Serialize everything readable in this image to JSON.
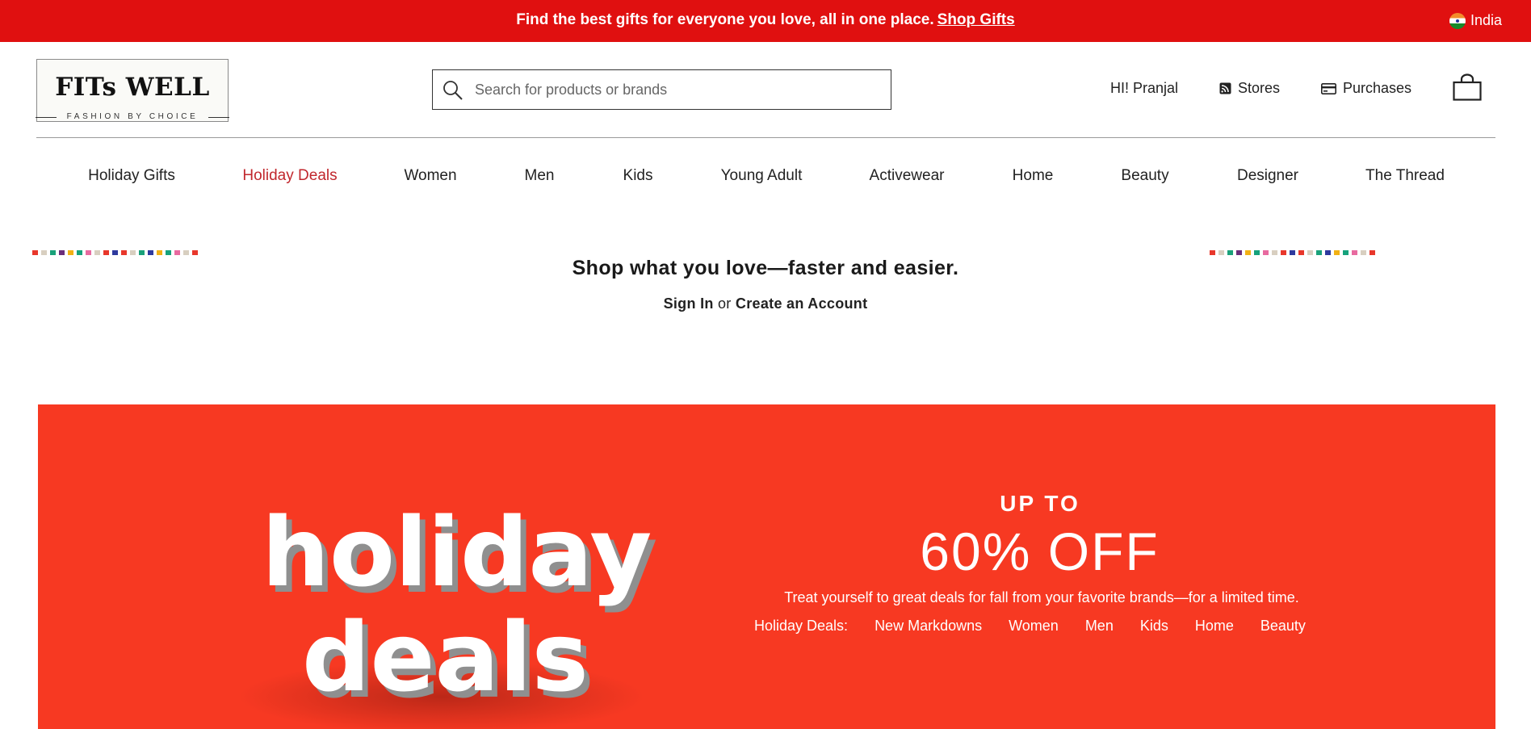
{
  "promo": {
    "text": "Find the best gifts for everyone you love, all in one place.",
    "link": "Shop Gifts",
    "country": "India",
    "background": "#e01010"
  },
  "header": {
    "logo_main": "FITs WELL",
    "logo_tagline": "FASHION BY CHOICE",
    "search_placeholder": "Search for products or brands",
    "greeting": "HI! Pranjal",
    "stores": "Stores",
    "purchases": "Purchases",
    "icons": [
      "search-icon",
      "stores-icon",
      "card-icon",
      "shopping-bag-icon"
    ]
  },
  "nav": {
    "items": [
      {
        "label": "Holiday Gifts"
      },
      {
        "label": "Holiday Deals",
        "active": true
      },
      {
        "label": "Women"
      },
      {
        "label": "Men"
      },
      {
        "label": "Kids"
      },
      {
        "label": "Young Adult"
      },
      {
        "label": "Activewear"
      },
      {
        "label": "Home"
      },
      {
        "label": "Beauty"
      },
      {
        "label": "Designer"
      },
      {
        "label": "The Thread"
      }
    ],
    "active_color": "#c1272d"
  },
  "account": {
    "title": "Shop what you love—faster and easier.",
    "sign_in": "Sign In",
    "or": "or",
    "create": "Create an Account"
  },
  "banner": {
    "art_text_line1": "holiday",
    "art_text_line2": "deals",
    "upto": "UP TO",
    "discount": "60% OFF",
    "description": "Treat yourself to great deals for fall from your favorite brands—for a limited time.",
    "links_label": "Holiday Deals:",
    "links": [
      "New Markdowns",
      "Women",
      "Men",
      "Kids",
      "Home",
      "Beauty"
    ],
    "background": "#f73922"
  },
  "confetti_colors": [
    "#e8372b",
    "#d8cfc0",
    "#1aa17a",
    "#6b2d7a",
    "#f2b114",
    "#16a27c",
    "#e86aa0",
    "#d8cfc0",
    "#e8372b",
    "#2e3a9e",
    "#e8372b",
    "#d8cfc0",
    "#1aa17a",
    "#2e3a9e",
    "#f2b114",
    "#16a27c",
    "#e86aa0",
    "#d8cfc0",
    "#e8372b"
  ]
}
